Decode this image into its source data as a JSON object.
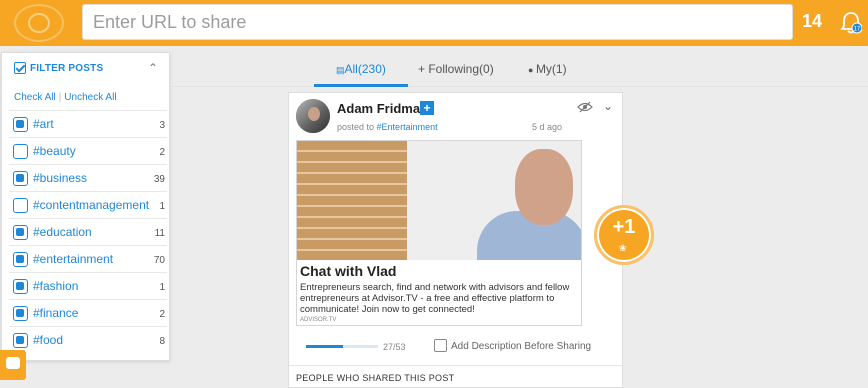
{
  "header": {
    "url_placeholder": "Enter URL to share",
    "count": "14",
    "notification_badge": "17"
  },
  "filter": {
    "title": "FILTER POSTS",
    "check_all": "Check All",
    "uncheck_all": "Uncheck All",
    "tags": [
      {
        "name": "#art",
        "count": "3",
        "checked": true
      },
      {
        "name": "#beauty",
        "count": "2",
        "checked": false
      },
      {
        "name": "#business",
        "count": "39",
        "checked": true
      },
      {
        "name": "#contentmanagement",
        "count": "1",
        "checked": false
      },
      {
        "name": "#education",
        "count": "11",
        "checked": true
      },
      {
        "name": "#entertainment",
        "count": "70",
        "checked": true
      },
      {
        "name": "#fashion",
        "count": "1",
        "checked": true
      },
      {
        "name": "#finance",
        "count": "2",
        "checked": true
      },
      {
        "name": "#food",
        "count": "8",
        "checked": true
      }
    ]
  },
  "tabs": [
    {
      "label": "All(230)",
      "active": true
    },
    {
      "label": "+ Following(0)",
      "active": false
    },
    {
      "label": "My(1)",
      "active": false
    }
  ],
  "post": {
    "author": "Adam Fridman",
    "posted_prefix": "posted to",
    "channel": "#Entertainment",
    "time": "5 d ago",
    "preview": {
      "title": "Chat with Vlad",
      "description": "Entrepreneurs search, find and network with advisors and fellow entrepreneurs at Advisor.TV - a free and effective platform to communicate! Join now to get connected!",
      "source": "ADVISOR.TV"
    },
    "plus_one": "+1",
    "progress": {
      "text": "27/53",
      "fraction": 0.509
    },
    "add_description_label": "Add Description Before Sharing",
    "shared_by_heading": "PEOPLE WHO SHARED THIS POST"
  },
  "colors": {
    "brand_orange": "#f6a623",
    "accent_blue": "#1e88d8"
  }
}
